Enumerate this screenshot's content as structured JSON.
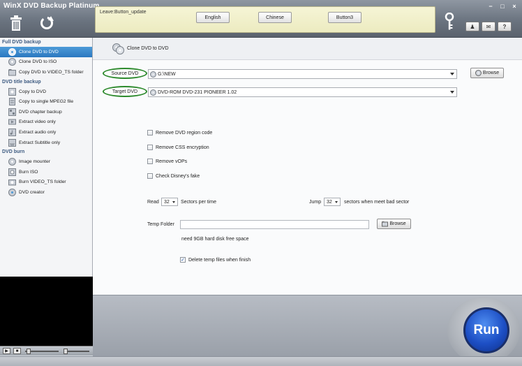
{
  "app": {
    "title": "WinX DVD Backup Platinum"
  },
  "header": {
    "note": "Leave:Button_update",
    "lang_buttons": [
      "English",
      "Chinese",
      "Button3"
    ],
    "window_controls": [
      "−",
      "□",
      "×"
    ],
    "tool_buttons": [
      {
        "icon": "person-icon",
        "label": "♟"
      },
      {
        "icon": "mail-icon",
        "label": "✉"
      },
      {
        "icon": "help-icon",
        "label": "?"
      }
    ]
  },
  "sidebar": {
    "sections": [
      {
        "title": "Full DVD backup",
        "items": [
          {
            "label": "Clone DVD to DVD",
            "icon": "disc-copy-icon",
            "active": true
          },
          {
            "label": "Clone DVD to ISO",
            "icon": "iso-icon",
            "active": false
          },
          {
            "label": "Copy DVD to VIDEO_TS folder",
            "icon": "folder-icon",
            "active": false
          }
        ]
      },
      {
        "title": "DVD title backup",
        "items": [
          {
            "label": "Copy to DVD",
            "icon": "disc-icon",
            "active": false
          },
          {
            "label": "Copy to single MPEG2 file",
            "icon": "file-icon",
            "active": false
          },
          {
            "label": "DVD chapter backup",
            "icon": "chapter-icon",
            "active": false
          },
          {
            "label": "Extract video only",
            "icon": "video-icon",
            "active": false
          },
          {
            "label": "Extract audio only",
            "icon": "audio-icon",
            "active": false
          },
          {
            "label": "Extract Subtitle only",
            "icon": "subtitle-icon",
            "active": false
          }
        ]
      },
      {
        "title": "DVD burn",
        "items": [
          {
            "label": "Image mounter",
            "icon": "mount-icon",
            "active": false
          },
          {
            "label": "Burn ISO",
            "icon": "burn-iso-icon",
            "active": false
          },
          {
            "label": "Burn VIDEO_TS folder",
            "icon": "burn-folder-icon",
            "active": false
          },
          {
            "label": "DVD creator",
            "icon": "creator-icon",
            "active": false
          }
        ]
      }
    ]
  },
  "player": {
    "play": "▶",
    "stop": "■"
  },
  "main": {
    "title": "Clone DVD to DVD",
    "source_label": "Source DVD",
    "source_value": "G:\\NEW",
    "browse_label": "Browse",
    "target_label": "Target DVD",
    "target_value": "DVD-ROM DVD-231  PIONEER  1.02",
    "options": [
      {
        "label": "Remove DVD region code",
        "checked": false
      },
      {
        "label": "Remove CSS encryption",
        "checked": false
      },
      {
        "label": "Remove vOPs",
        "checked": false
      },
      {
        "label": "Check Disney's fake",
        "checked": false
      }
    ],
    "read_label": "Read",
    "read_value": "32",
    "read_suffix": "Sectors per time",
    "jump_label": "Jump",
    "jump_value": "32",
    "jump_suffix": "sectors when meet bad sector",
    "temp_label": "Temp Folder",
    "temp_value": "",
    "temp_browse": "Browse",
    "disk_note": "need 9GB hard disk free space",
    "delete_temp": {
      "label": "Delete temp files when finish",
      "checked": true
    }
  },
  "run": {
    "label": "Run"
  },
  "colors": {
    "accent": "#2b78c0",
    "highlight_oval": "#2d8a2d",
    "run": "#1d4fc5"
  }
}
